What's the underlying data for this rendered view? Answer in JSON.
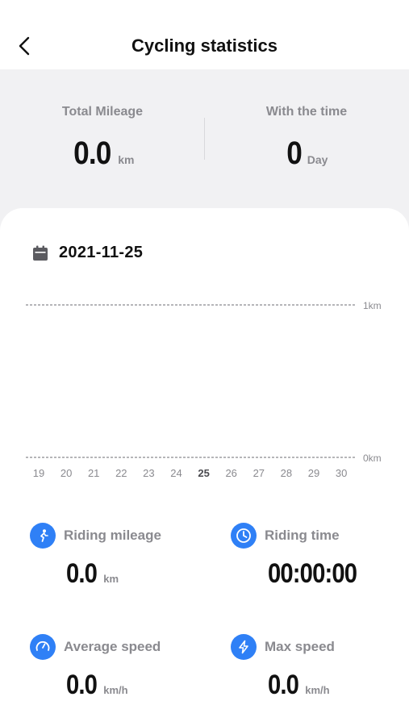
{
  "header": {
    "title": "Cycling statistics"
  },
  "summary": {
    "total_mileage": {
      "label": "Total Mileage",
      "value": "0.0",
      "unit": "km"
    },
    "with_the_time": {
      "label": "With the time",
      "value": "0",
      "unit": "Day"
    }
  },
  "date": "2021-11-25",
  "chart_data": {
    "type": "bar",
    "categories": [
      "19",
      "20",
      "21",
      "22",
      "23",
      "24",
      "25",
      "26",
      "27",
      "28",
      "29",
      "30"
    ],
    "values": [
      0,
      0,
      0,
      0,
      0,
      0,
      0,
      0,
      0,
      0,
      0,
      0
    ],
    "selected_category": "25",
    "ytick_labels": [
      "1km",
      "0km"
    ],
    "ylim": [
      0,
      1
    ],
    "grid": true
  },
  "stats": {
    "riding_mileage": {
      "label": "Riding mileage",
      "value": "0.0",
      "unit": "km",
      "icon": "cycling-icon"
    },
    "riding_time": {
      "label": "Riding time",
      "value": "00:00:00",
      "unit": "",
      "icon": "clock-icon"
    },
    "average_speed": {
      "label": "Average speed",
      "value": "0.0",
      "unit": "km/h",
      "icon": "speedometer-icon"
    },
    "max_speed": {
      "label": "Max speed",
      "value": "0.0",
      "unit": "km/h",
      "icon": "lightning-icon"
    }
  },
  "colors": {
    "accent": "#2f80f6",
    "background": "#f1f1f3",
    "muted_text": "#8a8a8f"
  }
}
